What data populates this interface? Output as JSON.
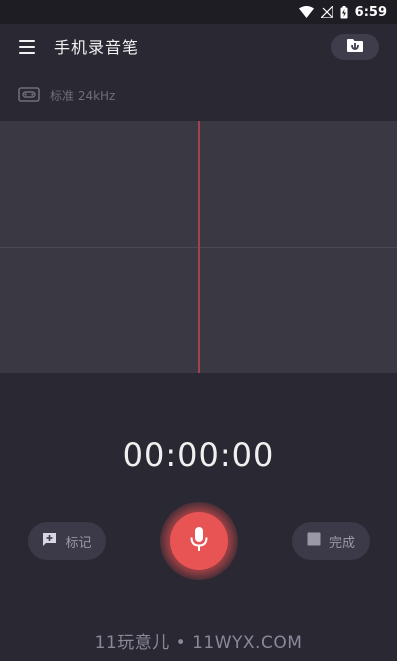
{
  "status_bar": {
    "time": "6:59"
  },
  "app_bar": {
    "title": "手机录音笔"
  },
  "quality": {
    "label": "标准 24kHz"
  },
  "recorder": {
    "timer": "00:00:00",
    "mark_label": "标记",
    "done_label": "完成"
  },
  "watermark": {
    "text": "11玩意儿 • 11WYX.COM"
  },
  "colors": {
    "background": "#2a2832",
    "wave_area": "#3a3842",
    "cursor_line": "#a3414f",
    "record_button": "#e85454",
    "pill_button": "#3c3a48"
  },
  "icons": {
    "menu": "hamburger-menu-icon",
    "folder": "folder-download-icon",
    "quality": "cassette-tape-icon",
    "mark": "flag-plus-icon",
    "record": "microphone-icon",
    "done": "stop-square-icon"
  }
}
